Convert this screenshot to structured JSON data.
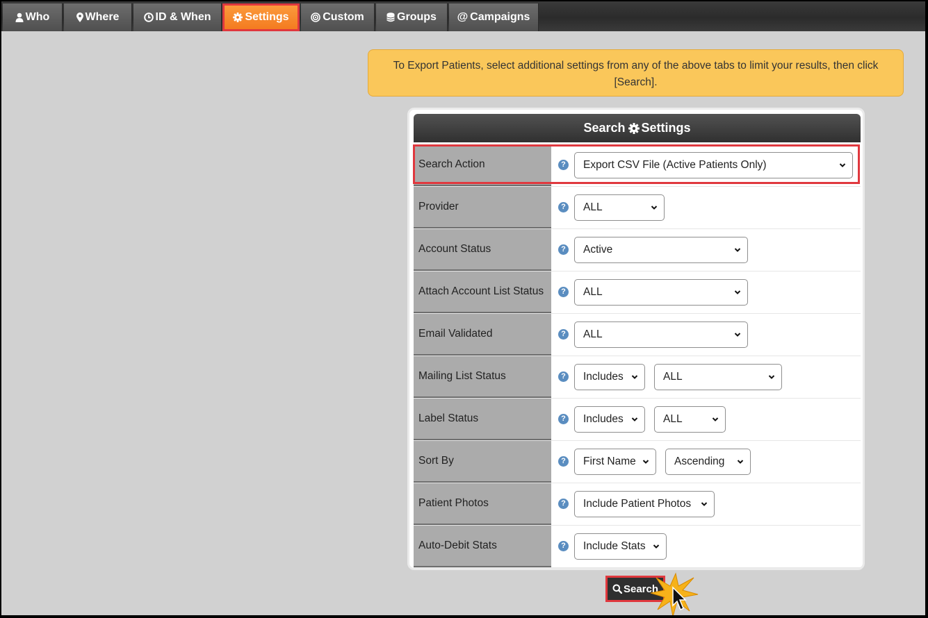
{
  "tabs": [
    {
      "label": "Who",
      "icon": "user-icon"
    },
    {
      "label": "Where",
      "icon": "map-pin-icon"
    },
    {
      "label": "ID & When",
      "icon": "clock-icon"
    },
    {
      "label": "Settings",
      "icon": "gear-icon",
      "active": true
    },
    {
      "label": "Custom",
      "icon": "target-icon"
    },
    {
      "label": "Groups",
      "icon": "database-icon"
    },
    {
      "label": "Campaigns",
      "icon": "at-icon"
    }
  ],
  "notice": {
    "text": "To Export Patients, select additional settings from any of the above tabs to limit your results, then click [Search]."
  },
  "panel": {
    "title_left": "Search",
    "title_right": "Settings",
    "rows": [
      {
        "label": "Search Action",
        "selects": [
          "Export CSV File (Active Patients Only)"
        ]
      },
      {
        "label": "Provider",
        "selects": [
          "ALL"
        ]
      },
      {
        "label": "Account Status",
        "selects": [
          "Active"
        ]
      },
      {
        "label": "Attach Account List Status",
        "selects": [
          "ALL"
        ]
      },
      {
        "label": "Email Validated",
        "selects": [
          "ALL"
        ]
      },
      {
        "label": "Mailing List Status",
        "selects": [
          "Includes",
          "ALL"
        ]
      },
      {
        "label": "Label Status",
        "selects": [
          "Includes",
          "ALL"
        ]
      },
      {
        "label": "Sort By",
        "selects": [
          "First Name",
          "Ascending"
        ]
      },
      {
        "label": "Patient Photos",
        "selects": [
          "Include Patient Photos"
        ]
      },
      {
        "label": "Auto-Debit Stats",
        "selects": [
          "Include Stats"
        ]
      }
    ],
    "help_glyph": "?"
  },
  "search_button": {
    "label": "Search"
  },
  "colors": {
    "active_tab": "#f47b20",
    "highlight": "#e0383e",
    "notice_bg": "#fac75a",
    "help_icon": "#5a8dc0"
  }
}
